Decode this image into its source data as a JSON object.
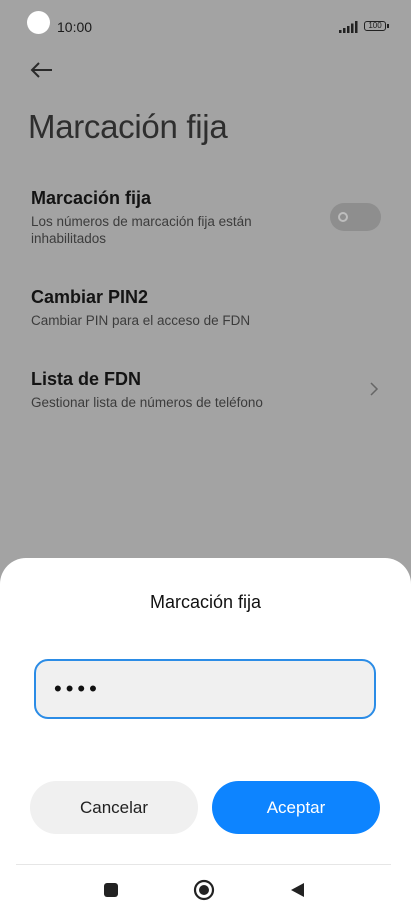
{
  "status_bar": {
    "time": "10:00",
    "battery": "100"
  },
  "page": {
    "title": "Marcación fija"
  },
  "settings": {
    "items": [
      {
        "title": "Marcación fija",
        "subtitle": "Los números de marcación fija están inhabilitados",
        "toggle_on": false
      },
      {
        "title": "Cambiar PIN2",
        "subtitle": "Cambiar PIN para el acceso de FDN"
      },
      {
        "title": "Lista de FDN",
        "subtitle": "Gestionar lista de números de teléfono"
      }
    ]
  },
  "dialog": {
    "title": "Marcación fija",
    "pin_value": "••••",
    "cancel_label": "Cancelar",
    "accept_label": "Aceptar"
  },
  "colors": {
    "accent": "#0d84ff",
    "input_border": "#2b8ce6",
    "dim_background": "#a3a3a3"
  },
  "icons": {
    "back": "arrow-left-icon",
    "chevron": "chevron-right-icon",
    "nav_recent": "square-icon",
    "nav_home": "circle-icon",
    "nav_back": "triangle-left-icon"
  }
}
